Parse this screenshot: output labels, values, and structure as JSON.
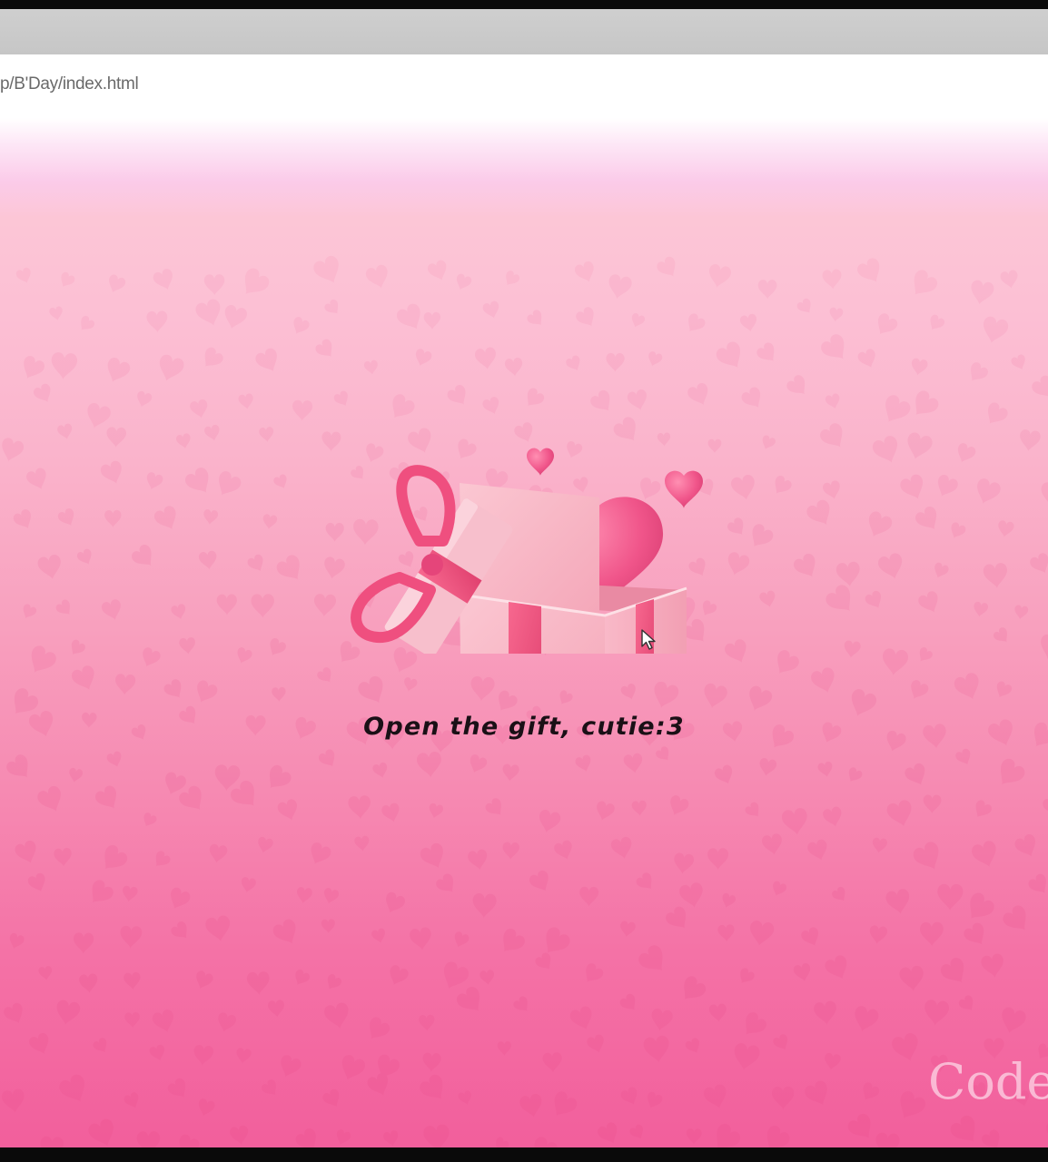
{
  "browser": {
    "url": "p/B'Day/index.html"
  },
  "page": {
    "caption": "Open the gift, cutie:3",
    "watermark": "Code"
  },
  "colors": {
    "gift_box": "#f7b3c2",
    "ribbon": "#ef4f7f",
    "heart": "#f0558a",
    "background_top": "#fcc6d6",
    "background_bottom": "#f25f9c"
  },
  "icons": {
    "gift": "open-gift-box-with-hearts",
    "cursor": "mouse-pointer"
  }
}
